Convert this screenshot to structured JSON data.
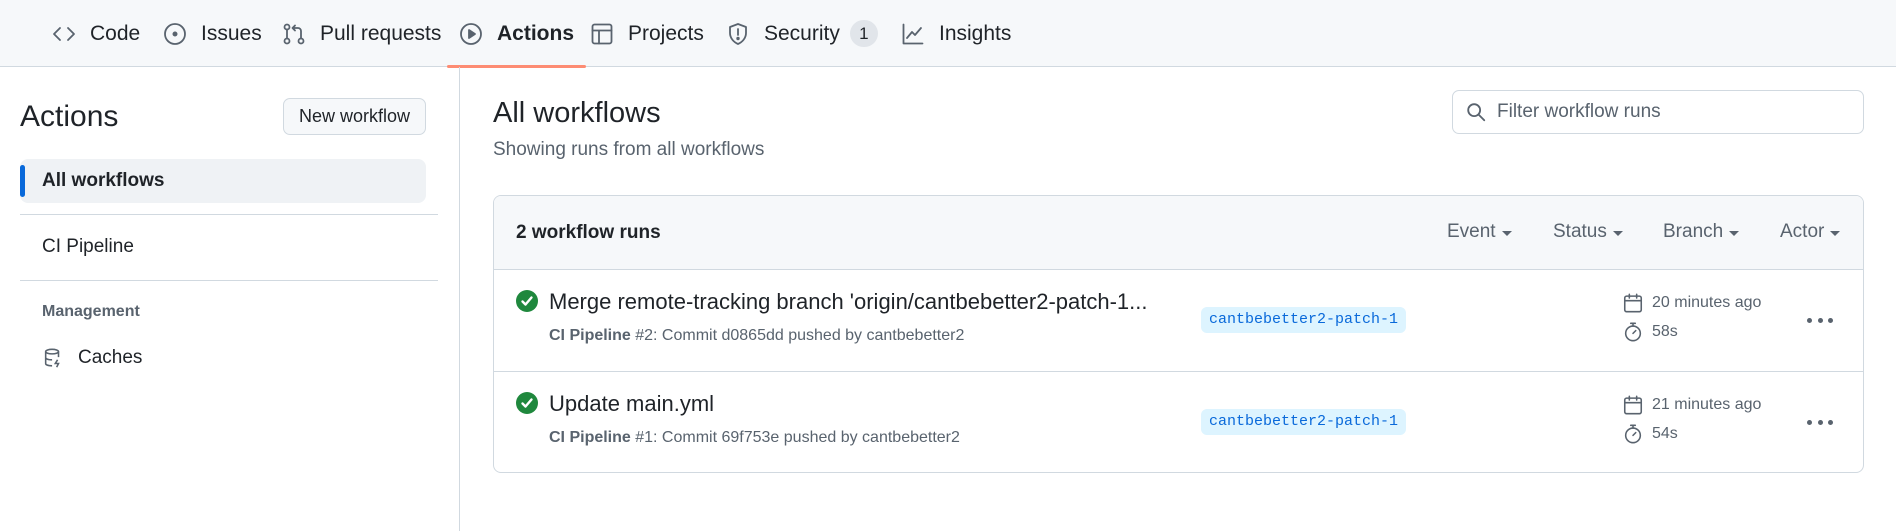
{
  "nav": {
    "tabs": [
      {
        "label": "Code",
        "icon": "code-icon"
      },
      {
        "label": "Issues",
        "icon": "issue-opened-icon"
      },
      {
        "label": "Pull requests",
        "icon": "git-pull-request-icon"
      },
      {
        "label": "Actions",
        "icon": "play-icon",
        "selected": true
      },
      {
        "label": "Projects",
        "icon": "table-icon"
      },
      {
        "label": "Security",
        "icon": "shield-icon",
        "counter": "1"
      },
      {
        "label": "Insights",
        "icon": "graph-icon"
      }
    ]
  },
  "sidebar": {
    "title": "Actions",
    "new_workflow_label": "New workflow",
    "items": [
      {
        "label": "All workflows",
        "active": true
      },
      {
        "label": "CI Pipeline"
      }
    ],
    "management_heading": "Management",
    "management_items": [
      {
        "label": "Caches",
        "icon": "database-icon"
      }
    ]
  },
  "main": {
    "title": "All workflows",
    "subtitle": "Showing runs from all workflows",
    "filter_placeholder": "Filter workflow runs",
    "runs_count": "2 workflow runs",
    "filters": [
      "Event",
      "Status",
      "Branch",
      "Actor"
    ],
    "runs": [
      {
        "title": "Merge remote-tracking branch 'origin/cantbebetter2-patch-1...",
        "workflow": "CI Pipeline",
        "meta": " #2: Commit d0865dd pushed by cantbebetter2",
        "branch": "cantbebetter2-patch-1",
        "when": "20 minutes ago",
        "duration": "58s",
        "status": "success"
      },
      {
        "title": "Update main.yml",
        "workflow": "CI Pipeline",
        "meta": " #1: Commit 69f753e pushed by cantbebetter2",
        "branch": "cantbebetter2-patch-1",
        "when": "21 minutes ago",
        "duration": "54s",
        "status": "success"
      }
    ]
  },
  "colors": {
    "accent": "#0969da",
    "success": "#1f883d",
    "tab_underline": "#fd8c73",
    "nav_bg": "#f6f8fa"
  }
}
